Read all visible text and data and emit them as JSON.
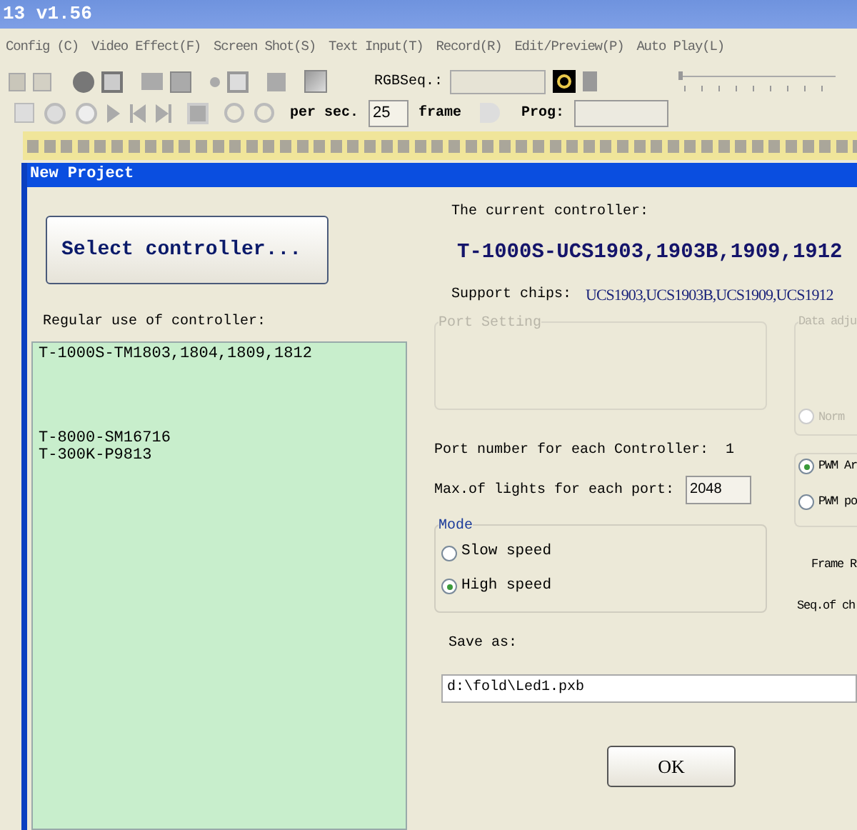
{
  "window": {
    "title": "13 v1.56"
  },
  "menu": [
    "Config (C)",
    "Video Effect(F)",
    "Screen Shot(S)",
    "Text Input(T)",
    "Record(R)",
    "Edit/Preview(P)",
    "Auto Play(L)"
  ],
  "toolbar": {
    "rgb_seq_label": "RGBSeq.:",
    "speed_slider": {
      "level": 0
    },
    "per_sec_label": "per sec.",
    "fps": "25",
    "frame_label": "frame",
    "prog_label": "Prog:"
  },
  "dialog": {
    "title": "New Project",
    "select_button": "Select controller...",
    "regular_label": "Regular use of controller:",
    "controllers": [
      {
        "label": "T-1000S-TM1803,1804,1809,1812"
      },
      {
        "label": "T-8000-SM16716"
      },
      {
        "label": "T-300K-P9813"
      }
    ],
    "current_label": "The current controller:",
    "current": "T-1000S-UCS1903,1903B,1909,1912",
    "support_label": "Support chips:",
    "support_chips": "UCS1903,UCS1903B,UCS1909,UCS1912",
    "port_setting": {
      "title": "Port Setting",
      "disabled": true
    },
    "data_adjust": {
      "title": "Data adju",
      "options": [
        {
          "label": "Norm",
          "selected": false,
          "disabled": true
        }
      ]
    },
    "port_number_label": "Port number for each Controller:",
    "port_number": "1",
    "max_lights_label": "Max.of lights for each port:",
    "max_lights": "2048",
    "pwm_options": [
      {
        "label": "PWM Ar",
        "selected": true
      },
      {
        "label": "PWM po",
        "selected": false
      }
    ],
    "mode": {
      "title": "Mode",
      "options": [
        {
          "label": "Slow speed",
          "selected": false
        },
        {
          "label": "High speed",
          "selected": true
        }
      ]
    },
    "frame_rate_label": "Frame R",
    "seq_label": "Seq.of ch",
    "save_as_label": "Save as:",
    "save_path": "d:\\fold\\Led1.pxb",
    "buttons": [
      "OK"
    ]
  }
}
